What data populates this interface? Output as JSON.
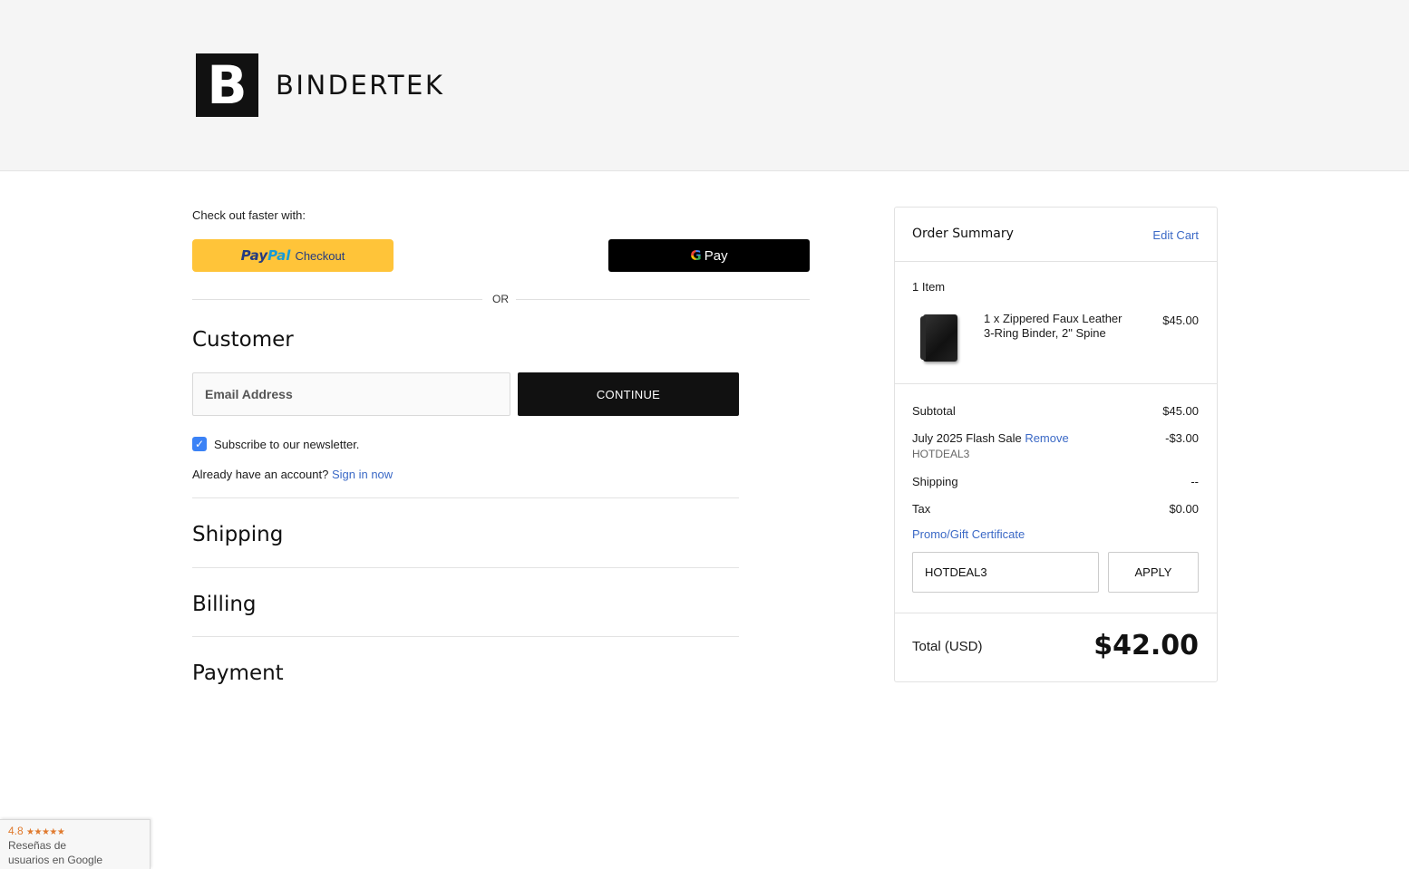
{
  "brand": {
    "mark": "B",
    "name": "BINDERTEK"
  },
  "express": {
    "label": "Check out faster with:",
    "paypal_pay": "Pay",
    "paypal_pal": "Pal",
    "paypal_checkout": "Checkout",
    "gpay_g": "G",
    "gpay_label": "Pay",
    "or": "OR"
  },
  "customer": {
    "heading": "Customer",
    "email_placeholder": "Email Address",
    "continue": "CONTINUE",
    "newsletter": "Subscribe to our newsletter.",
    "newsletter_checked": true,
    "account_prompt": "Already have an account?",
    "sign_in": "Sign in now"
  },
  "sections": {
    "shipping": "Shipping",
    "billing": "Billing",
    "payment": "Payment"
  },
  "summary": {
    "title": "Order Summary",
    "edit_cart": "Edit Cart",
    "items_count": "1 Item",
    "item": {
      "name": "1 x Zippered Faux Leather 3-Ring Binder, 2\" Spine",
      "price": "$45.00"
    },
    "subtotal_label": "Subtotal",
    "subtotal": "$45.00",
    "discount_label": "July 2025 Flash Sale",
    "remove": "Remove",
    "discount": "-$3.00",
    "coupon_code": "HOTDEAL3",
    "shipping_label": "Shipping",
    "shipping": "--",
    "tax_label": "Tax",
    "tax": "$0.00",
    "promo_link": "Promo/Gift Certificate",
    "promo_value": "HOTDEAL3",
    "apply": "APPLY",
    "total_label": "Total (USD)",
    "total": "$42.00"
  },
  "reviews": {
    "rating": "4.8",
    "stars": "★★★★★",
    "line1": "Reseñas de",
    "line2": "usuarios en Google"
  },
  "colors": {
    "paypal_yellow": "#ffc439",
    "link_blue": "#3b69c6",
    "checkbox_blue": "#3b82f6",
    "dark": "#111111"
  }
}
